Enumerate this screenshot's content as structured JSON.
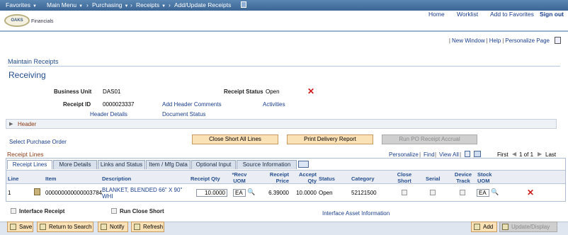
{
  "topnav": {
    "favorites": "Favorites",
    "main_menu": "Main Menu",
    "purchasing": "Purchasing",
    "receipts": "Receipts",
    "current": "Add/Update Receipts"
  },
  "brand": {
    "logo": "OAKS",
    "product": "Financials"
  },
  "header_links": {
    "home": "Home",
    "worklist": "Worklist",
    "add_favorites": "Add to Favorites",
    "sign_out": "Sign out"
  },
  "page_links": {
    "new_window": "New Window",
    "help": "Help",
    "personalize": "Personalize Page"
  },
  "section_title": "Maintain Receipts",
  "page_title": "Receiving",
  "form": {
    "business_unit_label": "Business Unit",
    "business_unit": "DAS01",
    "receipt_status_label": "Receipt Status",
    "receipt_status": "Open",
    "receipt_id_label": "Receipt ID",
    "receipt_id": "0000023337",
    "add_header_comments": "Add Header Comments",
    "activities": "Activities",
    "header_details": "Header Details",
    "document_status": "Document Status"
  },
  "header_section": "Header",
  "purchase_order_link": "Select Purchase Order",
  "actions": {
    "close_short": "Close Short All Lines",
    "print_delivery": "Print Delivery Report",
    "run_po_accrual": "Run PO Receipt Accrual"
  },
  "grid": {
    "title": "Receipt Lines",
    "personalize": "Personalize",
    "find": "Find",
    "view_all": "View All",
    "first": "First",
    "pager": "1 of 1",
    "last": "Last",
    "tabs": [
      "Receipt Lines",
      "More Details",
      "Links and Status",
      "Item / Mfg Data",
      "Optional Input",
      "Source Information"
    ],
    "columns": {
      "line": "Line",
      "item": "Item",
      "description": "Description",
      "receipt_qty": "Receipt Qty",
      "recv_uom_1": "*Recv",
      "recv_uom_2": "UOM",
      "receipt_price_1": "Receipt",
      "receipt_price_2": "Price",
      "accept_qty_1": "Accept",
      "accept_qty_2": "Qty",
      "status": "Status",
      "category": "Category",
      "close_short_1": "Close",
      "close_short_2": "Short",
      "serial": "Serial",
      "device_track_1": "Device",
      "device_track_2": "Track",
      "stock_uom_1": "Stock",
      "stock_uom_2": "UOM"
    },
    "row": {
      "line": "1",
      "item": "000000000000003784",
      "description_1": "BLANKET, BLENDED 66\" X 90\"",
      "description_2": "WHI",
      "receipt_qty": "10.0000",
      "recv_uom": "EA",
      "receipt_price": "6.39000",
      "accept_qty": "10.0000",
      "status": "Open",
      "category": "52121500",
      "stock_uom": "EA"
    }
  },
  "options": {
    "interface_receipt": "Interface Receipt",
    "run_close_short": "Run Close Short",
    "interface_asset": "Interface Asset Information"
  },
  "footer": {
    "save": "Save",
    "return_to_search": "Return to Search",
    "notify": "Notify",
    "refresh": "Refresh",
    "add": "Add",
    "update_display": "Update/Display"
  }
}
